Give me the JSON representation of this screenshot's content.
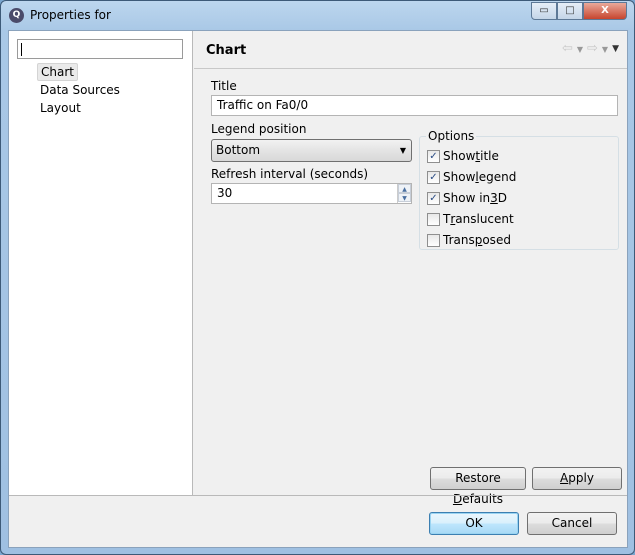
{
  "window": {
    "title": "Properties for",
    "app_icon": "Q",
    "minimize": "▭",
    "maximize": "□",
    "close": "X"
  },
  "sidebar": {
    "filter_value": "",
    "items": [
      {
        "label": "Chart",
        "selected": true
      },
      {
        "label": "Data Sources"
      },
      {
        "label": "Layout"
      }
    ]
  },
  "page": {
    "title": "Chart",
    "nav": {
      "back": "⇦",
      "forward": "⇨",
      "dropdown": "▼",
      "menu": "▼"
    }
  },
  "form": {
    "title_label": "Title",
    "title_value": "Traffic on Fa0/0",
    "legend_label": "Legend position",
    "legend_value": "Bottom",
    "legend_arrow": "▼",
    "refresh_label": "Refresh interval (seconds)",
    "refresh_value": "30",
    "spin_up": "▲",
    "spin_down": "▼",
    "options_label": "Options",
    "options": [
      {
        "pre": "Show ",
        "key": "t",
        "post": "itle",
        "checked": true
      },
      {
        "pre": "Show ",
        "key": "l",
        "post": "egend",
        "checked": true
      },
      {
        "pre": "Show in ",
        "key": "3",
        "post": "D",
        "checked": true
      },
      {
        "pre": "T",
        "key": "r",
        "post": "anslucent",
        "checked": false
      },
      {
        "pre": "Trans",
        "key": "p",
        "post": "osed",
        "checked": false
      }
    ],
    "check_mark": "✓"
  },
  "buttons": {
    "restore": {
      "pre": "Restore ",
      "key": "D",
      "post": "efaults"
    },
    "apply": {
      "pre": "",
      "key": "A",
      "post": "pply"
    },
    "ok": "OK",
    "cancel": "Cancel"
  }
}
